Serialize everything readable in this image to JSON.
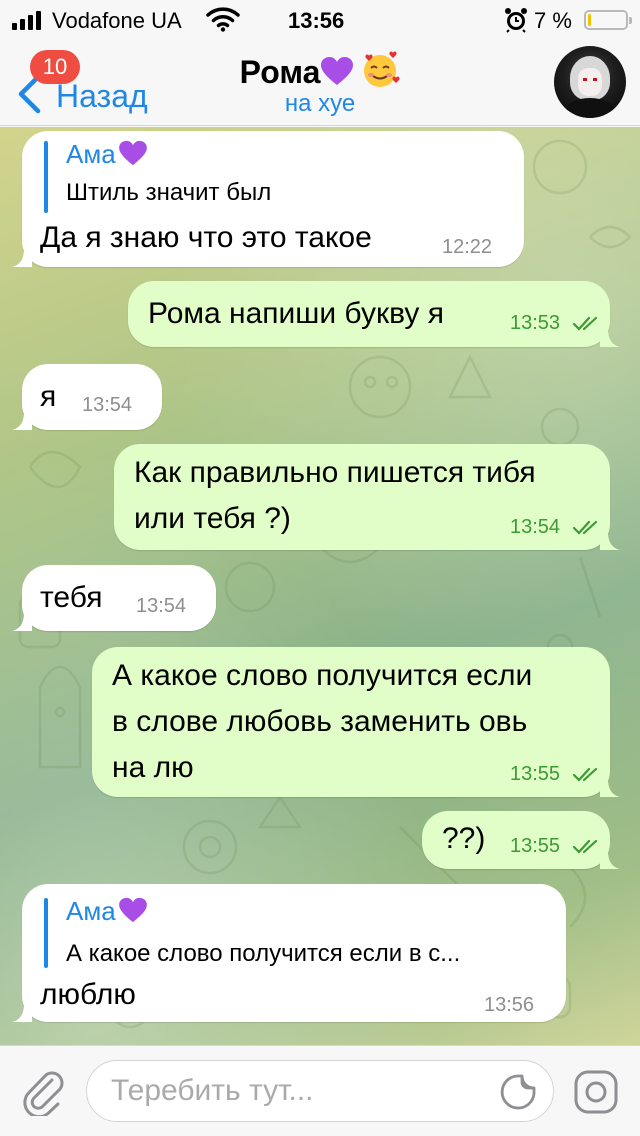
{
  "status_bar": {
    "carrier": "Vodafone UA",
    "time": "13:56",
    "battery_percent": "7 %",
    "battery_level": 0.07,
    "battery_color": "#f2c200"
  },
  "header": {
    "back_label": "Назад",
    "unread_count": "10",
    "chat_name": "Рома",
    "status": "на хуе",
    "icons": [
      "chevron-left-icon",
      "purple-heart-emoji",
      "smiling-face-with-hearts-emoji",
      "avatar"
    ]
  },
  "messages": [
    {
      "direction": "incoming",
      "reply_to": {
        "author": "Ама",
        "text": "Штиль значит был"
      },
      "text": "Да я знаю что это такое",
      "time": "12:22"
    },
    {
      "direction": "outgoing",
      "text": "Рома напиши букву я",
      "time": "13:53",
      "read": true
    },
    {
      "direction": "incoming",
      "text": "я",
      "time": "13:54"
    },
    {
      "direction": "outgoing",
      "lines": [
        "Как правильно пишется тибя",
        "или тебя ?)"
      ],
      "time": "13:54",
      "read": true
    },
    {
      "direction": "incoming",
      "text": "тебя",
      "time": "13:54"
    },
    {
      "direction": "outgoing",
      "lines": [
        "А какое слово получится если",
        "в слове любовь заменить овь",
        "на лю"
      ],
      "time": "13:55",
      "read": true
    },
    {
      "direction": "outgoing",
      "text": "??)",
      "time": "13:55",
      "read": true
    },
    {
      "direction": "incoming",
      "reply_to": {
        "author": "Ама",
        "text": "А какое слово получится если в с..."
      },
      "text": "люблю",
      "time": "13:56"
    }
  ],
  "input_bar": {
    "placeholder": "Теребить тут...",
    "icons": [
      "paperclip-icon",
      "sticker-icon",
      "camera-icon"
    ]
  },
  "colors": {
    "accent": "#1f87e6",
    "outgoing_bubble": "#e1fdc8",
    "incoming_bubble": "#ffffff",
    "outgoing_time": "#3d9a35",
    "badge": "#ef4c42",
    "heart": "#a84ee6"
  }
}
